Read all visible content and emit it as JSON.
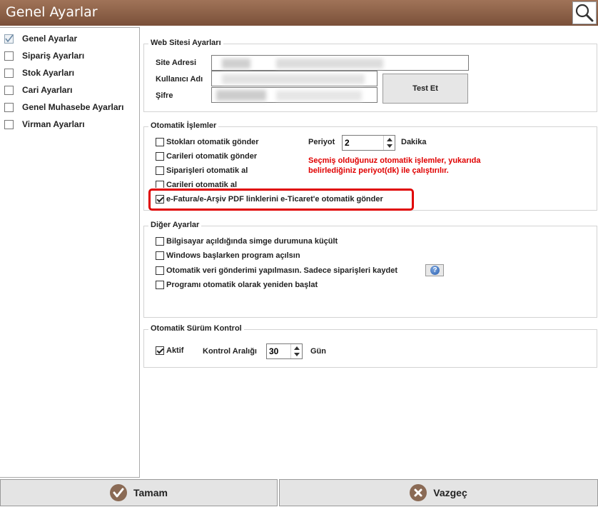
{
  "window": {
    "title": "Genel Ayarlar"
  },
  "sidebar": {
    "items": [
      {
        "label": "Genel Ayarlar",
        "checked": true
      },
      {
        "label": "Sipariş Ayarları",
        "checked": false
      },
      {
        "label": "Stok Ayarları",
        "checked": false
      },
      {
        "label": "Cari Ayarları",
        "checked": false
      },
      {
        "label": "Genel Muhasebe Ayarları",
        "checked": false
      },
      {
        "label": "Virman Ayarları",
        "checked": false
      }
    ]
  },
  "web": {
    "legend": "Web Sitesi Ayarları",
    "site_label": "Site Adresi",
    "user_label": "Kullanıcı Adı",
    "password_label": "Şifre",
    "test_button": "Test Et"
  },
  "auto": {
    "legend": "Otomatik İşlemler",
    "options": [
      {
        "label": "Stokları otomatik gönder",
        "checked": false
      },
      {
        "label": "Carileri otomatik gönder",
        "checked": false
      },
      {
        "label": "Siparişleri otomatik al",
        "checked": false
      },
      {
        "label": "Carileri otomatik al",
        "checked": false
      }
    ],
    "efatura": {
      "label": "e-Fatura/e-Arşiv PDF linklerini e-Ticaret'e otomatik gönder",
      "checked": true
    },
    "period_label": "Periyot",
    "period_value": "2",
    "period_unit": "Dakika",
    "note": "Seçmiş olduğunuz otomatik işlemler, yukarıda belirlediğiniz periyot(dk) ile çalıştırılır."
  },
  "other": {
    "legend": "Diğer Ayarlar",
    "options": [
      {
        "label": "Bilgisayar açıldığında simge durumuna küçült",
        "checked": false
      },
      {
        "label": "Windows başlarken program açılsın",
        "checked": false
      },
      {
        "label": "Otomatik veri gönderimi yapılmasın. Sadece siparişleri kaydet",
        "checked": false
      },
      {
        "label": "Programı otomatik olarak yeniden başlat",
        "checked": false
      }
    ],
    "help_icon": "question-icon"
  },
  "version": {
    "legend": "Otomatik Sürüm Kontrol",
    "active_label": "Aktif",
    "active_checked": true,
    "interval_label": "Kontrol Aralığı",
    "interval_value": "30",
    "interval_unit": "Gün"
  },
  "footer": {
    "ok_label": "Tamam",
    "ok_icon": "check-icon",
    "cancel_label": "Vazgeç",
    "cancel_icon": "close-icon"
  },
  "colors": {
    "accent_red": "#e00000",
    "titlebar": "#8a5e45"
  }
}
